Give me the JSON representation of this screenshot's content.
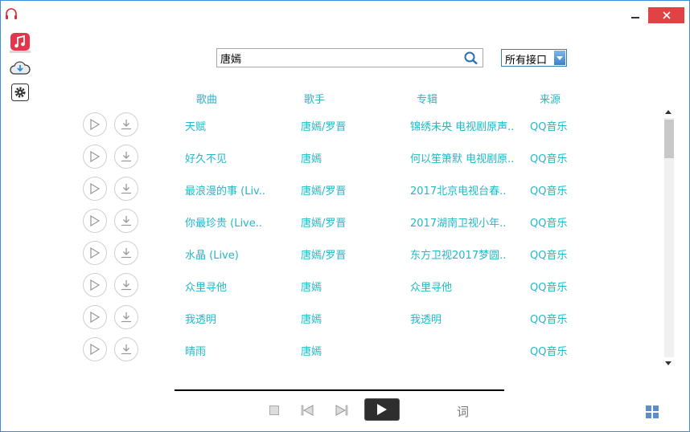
{
  "search": {
    "query": "唐嫣"
  },
  "source_select": {
    "selected": "所有接口"
  },
  "columns": {
    "song": "歌曲",
    "artist": "歌手",
    "album": "专辑",
    "source": "来源"
  },
  "songs": [
    {
      "title": "天赋",
      "artist": "唐嫣/罗晋",
      "album": "锦绣未央 电视剧原声..",
      "source": "QQ音乐"
    },
    {
      "title": "好久不见",
      "artist": "唐嫣",
      "album": "何以笙箫默 电视剧原..",
      "source": "QQ音乐"
    },
    {
      "title": "最浪漫的事 (Liv..",
      "artist": "唐嫣/罗晋",
      "album": "2017北京电视台春..",
      "source": "QQ音乐"
    },
    {
      "title": "你最珍贵 (Live..",
      "artist": "唐嫣/罗晋",
      "album": "2017湖南卫视小年..",
      "source": "QQ音乐"
    },
    {
      "title": "水晶 (Live)",
      "artist": "唐嫣/罗晋",
      "album": "东方卫视2017梦圆..",
      "source": "QQ音乐"
    },
    {
      "title": "众里寻他",
      "artist": "唐嫣",
      "album": "众里寻他",
      "source": "QQ音乐"
    },
    {
      "title": "我透明",
      "artist": "唐嫣",
      "album": "我透明",
      "source": "QQ音乐"
    },
    {
      "title": "晴雨",
      "artist": "唐嫣",
      "album": "",
      "source": "QQ音乐"
    },
    {
      "title": "",
      "artist": "",
      "album": "",
      "source": ""
    }
  ],
  "player": {
    "lyrics_label": "词"
  },
  "colors": {
    "accent_text": "#22b8c8",
    "close_button": "#e04343",
    "window_border": "#3c8cd8"
  }
}
